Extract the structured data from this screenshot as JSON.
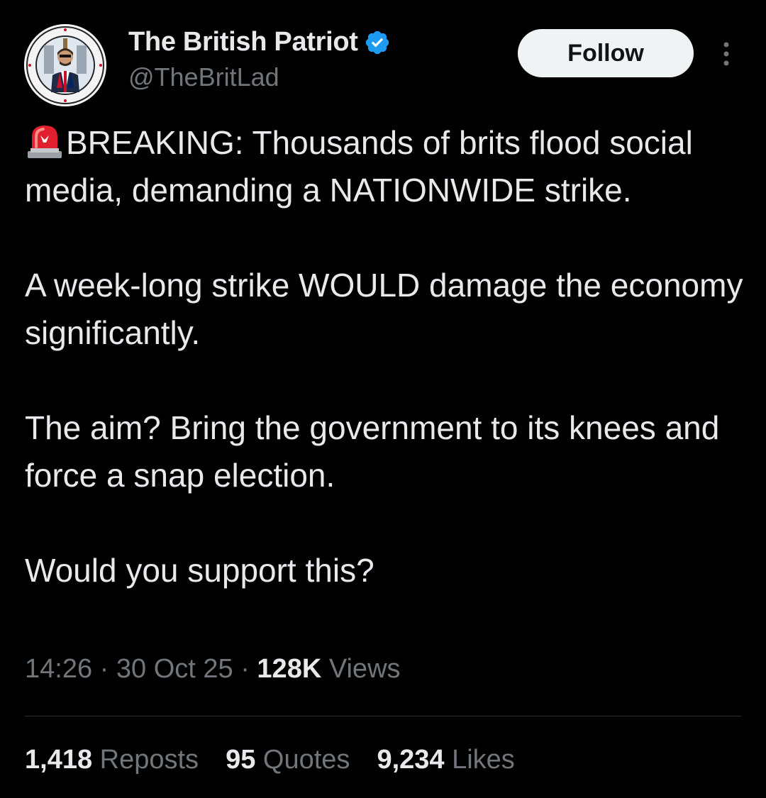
{
  "author": {
    "display_name": "The British Patriot",
    "handle": "@TheBritLad",
    "verified": true,
    "avatar": "round-badge-avatar-with-union-jack-figure"
  },
  "follow_button": {
    "label": "Follow"
  },
  "more_menu": {
    "icon": "more-vertical-icon"
  },
  "tweet": {
    "line1_rest": "BREAKING: Thousands of brits flood social media, demanding a NATIONWIDE strike.",
    "para2": "A week-long strike WOULD damage the economy significantly.",
    "para3": "The aim? Bring the government to its knees and force a snap election.",
    "para4": "Would you support this?",
    "leading_emoji": "siren-icon"
  },
  "meta": {
    "time": "14:26",
    "date": "30 Oct 25",
    "separator": "·",
    "views_count": "128K",
    "views_label": "Views"
  },
  "stats": {
    "reposts_count": "1,418",
    "reposts_label": "Reposts",
    "quotes_count": "95",
    "quotes_label": "Quotes",
    "likes_count": "9,234",
    "likes_label": "Likes"
  },
  "colors": {
    "background": "#000000",
    "text_primary": "#e7e9ea",
    "text_secondary": "#71767b",
    "verified_blue": "#1d9bf0",
    "divider": "#2f3336",
    "follow_bg": "#eff3f4"
  }
}
